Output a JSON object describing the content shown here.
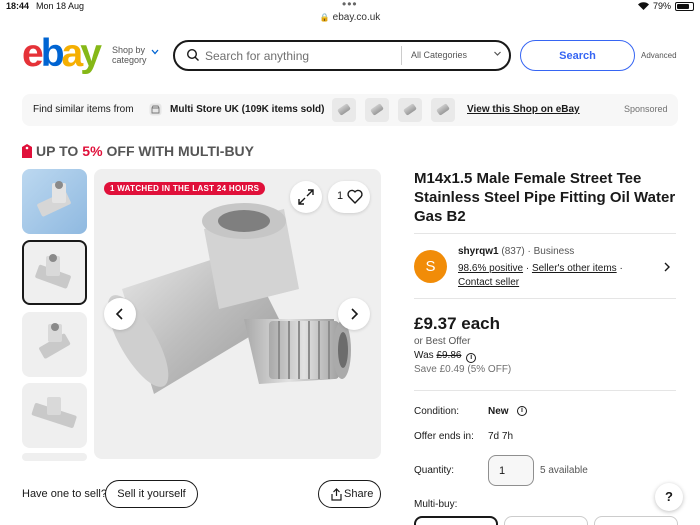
{
  "status_bar": {
    "time": "18:44",
    "date": "Mon 18 Aug",
    "battery": "79%",
    "battery_level": 0.79
  },
  "browser": {
    "url": "ebay.co.uk"
  },
  "header": {
    "logo": {
      "e": "e",
      "b": "b",
      "a": "a",
      "y": "y"
    },
    "shop_by_line1": "Shop by",
    "shop_by_line2": "category",
    "search_placeholder": "Search for anything",
    "category_select": "All Categories",
    "search_button": "Search",
    "advanced": "Advanced"
  },
  "similar_bar": {
    "find_text": "Find similar items from",
    "store": "Multi Store UK",
    "items_sold": "(109K items sold)",
    "view_shop": "View this Shop on eBay",
    "sponsored": "Sponsored"
  },
  "promo": {
    "prefix": "UP TO",
    "percent": "5%",
    "suffix": "OFF WITH MULTI-BUY"
  },
  "gallery": {
    "watched_badge": "1 WATCHED IN THE LAST 24 HOURS",
    "watch_count": "1"
  },
  "sell": {
    "question": "Have one to sell?",
    "button": "Sell it yourself",
    "share": "Share"
  },
  "item": {
    "title": "M14x1.5 Male Female Street Tee Stainless Steel Pipe Fitting Oil Water Gas B2",
    "seller": {
      "initial": "S",
      "name": "shyrqw1",
      "feedback_count": "(837)",
      "type": "Business",
      "positive": "98.6% positive",
      "other_items": "Seller's other items",
      "contact": "Contact seller"
    },
    "price": "£9.37 each",
    "best_offer": "or Best Offer",
    "was_label": "Was",
    "was_price": "£9.86",
    "save": "Save £0.49 (5% OFF)",
    "condition_label": "Condition:",
    "condition_value": "New",
    "offer_ends_label": "Offer ends in:",
    "offer_ends_value": "7d 7h",
    "quantity_label": "Quantity:",
    "quantity_value": "1",
    "available": "5 available",
    "multibuy_label": "Multi-buy:"
  },
  "help": "?",
  "icons": {
    "search": "search-icon",
    "chevron": "chevron-down-icon",
    "store": "store-icon",
    "tag": "tag-icon",
    "expand": "expand-icon",
    "heart": "heart-icon",
    "prev": "chevron-left-icon",
    "next": "chevron-right-icon",
    "share": "share-icon",
    "info": "info-icon"
  },
  "colors": {
    "ebay_red": "#e53238",
    "ebay_blue": "#0064d2",
    "ebay_yellow": "#f5af02",
    "ebay_green": "#86b817",
    "accent": "#3665f3",
    "badge": "#e0103a",
    "avatar": "#f18c08"
  }
}
